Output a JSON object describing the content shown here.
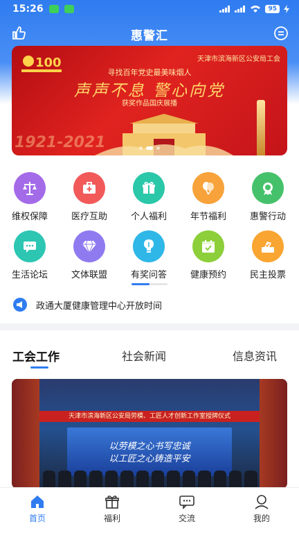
{
  "status_bar": {
    "time": "15:26",
    "battery": "95"
  },
  "header": {
    "title": "惠警汇"
  },
  "banner": {
    "org": "天津市滨海新区公安局工会",
    "subtitle_top": "寻找百年党史最美味烟人",
    "headline": "声声不息 警心向党",
    "subtitle_bottom": "获奖作品国庆展播",
    "years": "1921-2021",
    "emblem_text": "100"
  },
  "grid": {
    "items": [
      {
        "label": "维权保障",
        "color": "#a46be9",
        "icon": "scales-icon"
      },
      {
        "label": "医疗互助",
        "color": "#f25a5a",
        "icon": "medical-kit-icon"
      },
      {
        "label": "个人福利",
        "color": "#2bc7a9",
        "icon": "gift-icon"
      },
      {
        "label": "年节福利",
        "color": "#f7a23a",
        "icon": "balloon-icon"
      },
      {
        "label": "惠警行动",
        "color": "#46c16b",
        "icon": "badge-icon"
      },
      {
        "label": "生活论坛",
        "color": "#2cc6b3",
        "icon": "chat-icon"
      },
      {
        "label": "文体联盟",
        "color": "#8f7bef",
        "icon": "diamond-icon"
      },
      {
        "label": "有奖问答",
        "color": "#2fb7e8",
        "icon": "lightbulb-icon"
      },
      {
        "label": "健康预约",
        "color": "#8ccf3a",
        "icon": "calendar-icon"
      },
      {
        "label": "民主投票",
        "color": "#f9a531",
        "icon": "vote-icon"
      }
    ]
  },
  "notice": {
    "text": "政通大厦健康管理中心开放时间"
  },
  "tabs": [
    {
      "label": "工会工作",
      "active": true
    },
    {
      "label": "社会新闻",
      "active": false
    },
    {
      "label": "信息资讯",
      "active": false
    }
  ],
  "photo": {
    "stage_banner": "天津市滨海新区公安局劳模、工匠人才创新工作室授牌仪式",
    "screen_line1": "以劳模之心书写忠诚",
    "screen_line2": "以工匠之心铸造平安"
  },
  "bottom_nav": [
    {
      "label": "首页",
      "icon": "home-icon",
      "active": true
    },
    {
      "label": "福利",
      "icon": "gift-icon",
      "active": false
    },
    {
      "label": "交流",
      "icon": "chat-icon",
      "active": false
    },
    {
      "label": "我的",
      "icon": "user-icon",
      "active": false
    }
  ],
  "colors": {
    "primary": "#2f7cf0",
    "banner_red": "#d01c1c"
  }
}
